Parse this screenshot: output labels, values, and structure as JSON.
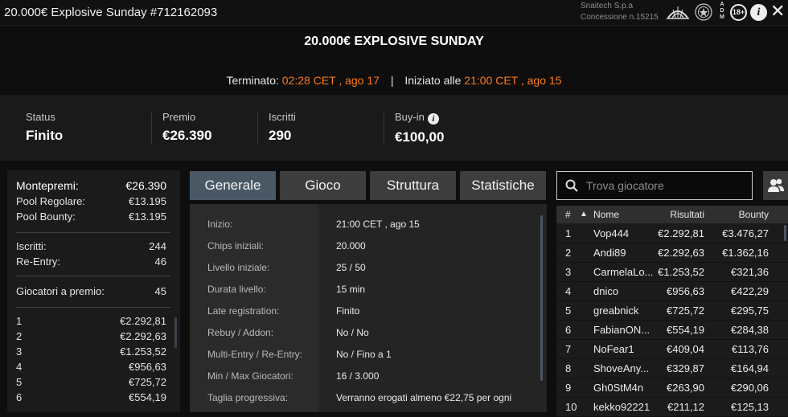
{
  "window": {
    "title": "20.000€ Explosive Sunday #712162093",
    "brand_line1": "Snaitech S.p.a",
    "brand_line2": "Concessione n.15215",
    "adm_vertical": [
      "A",
      "D",
      "M"
    ],
    "age_badge": "18+",
    "info_icon": "i",
    "close_icon": "✕"
  },
  "tournament": {
    "name": "20.000€ EXPLOSIVE SUNDAY",
    "ended_label": "Terminato:",
    "ended_value": "02:28 CET , ago 17",
    "separator": "|",
    "started_label": "Iniziato alle",
    "started_value": "21:00 CET , ago 15"
  },
  "stats": {
    "status_label": "Status",
    "status_value": "Finito",
    "prize_label": "Premio",
    "prize_value": "€26.390",
    "entries_label": "Iscritti",
    "entries_value": "290",
    "buyin_label": "Buy-in",
    "buyin_value": "€100,00",
    "buyin_info_icon": "i"
  },
  "summary": {
    "montepremi_label": "Montepremi:",
    "montepremi_value": "€26.390",
    "pool_regolare_label": "Pool Regolare:",
    "pool_regolare_value": "€13.195",
    "pool_bounty_label": "Pool Bounty:",
    "pool_bounty_value": "€13.195",
    "iscritti_label": "Iscritti:",
    "iscritti_value": "244",
    "reentry_label": "Re-Entry:",
    "reentry_value": "46",
    "giocatori_premio_label": "Giocatori a premio:",
    "giocatori_premio_value": "45",
    "payouts": [
      {
        "place": "1",
        "amount": "€2.292,81"
      },
      {
        "place": "2",
        "amount": "€2.292,63"
      },
      {
        "place": "3",
        "amount": "€1.253,52"
      },
      {
        "place": "4",
        "amount": "€956,63"
      },
      {
        "place": "5",
        "amount": "€725,72"
      },
      {
        "place": "6",
        "amount": "€554,19"
      }
    ]
  },
  "tabs": [
    "Generale",
    "Gioco",
    "Struttura",
    "Statistiche"
  ],
  "generale": [
    {
      "label": "Inizio:",
      "value": "21:00 CET , ago 15"
    },
    {
      "label": "Chips iniziali:",
      "value": "20.000"
    },
    {
      "label": "Livello iniziale:",
      "value": "25 / 50"
    },
    {
      "label": "Durata livello:",
      "value": "15 min"
    },
    {
      "label": "Late registration:",
      "value": "Finito"
    },
    {
      "label": "Rebuy / Addon:",
      "value": "No / No"
    },
    {
      "label": "Multi-Entry / Re-Entry:",
      "value": "No / Fino a 1"
    },
    {
      "label": "Min / Max Giocatori:",
      "value": "16 / 3.000"
    },
    {
      "label": "Taglia progressiva:",
      "value": "Verranno erogati almeno €22,75 per ogni"
    }
  ],
  "search": {
    "placeholder": "Trova giocatore"
  },
  "players": {
    "header": {
      "rank": "#",
      "sort_icon": "▲",
      "name": "Nome",
      "results": "Risultati",
      "bounty": "Bounty"
    },
    "rows": [
      {
        "rank": "1",
        "name": "Vop444",
        "results": "€2.292,81",
        "bounty": "€3.476,27"
      },
      {
        "rank": "2",
        "name": "Andi89",
        "results": "€2.292,63",
        "bounty": "€1.362,16"
      },
      {
        "rank": "3",
        "name": "CarmelaLo...",
        "results": "€1.253,52",
        "bounty": "€321,36"
      },
      {
        "rank": "4",
        "name": "dnico",
        "results": "€956,63",
        "bounty": "€422,29"
      },
      {
        "rank": "5",
        "name": "greabnick",
        "results": "€725,72",
        "bounty": "€295,75"
      },
      {
        "rank": "6",
        "name": "FabianON...",
        "results": "€554,19",
        "bounty": "€284,38"
      },
      {
        "rank": "7",
        "name": "NoFear1",
        "results": "€409,04",
        "bounty": "€113,76"
      },
      {
        "rank": "8",
        "name": "ShoveAny...",
        "results": "€329,87",
        "bounty": "€164,94"
      },
      {
        "rank": "9",
        "name": "Gh0StM4n",
        "results": "€263,90",
        "bounty": "€290,06"
      },
      {
        "rank": "10",
        "name": "kekko92221",
        "results": "€211,12",
        "bounty": "€125,13"
      }
    ]
  }
}
